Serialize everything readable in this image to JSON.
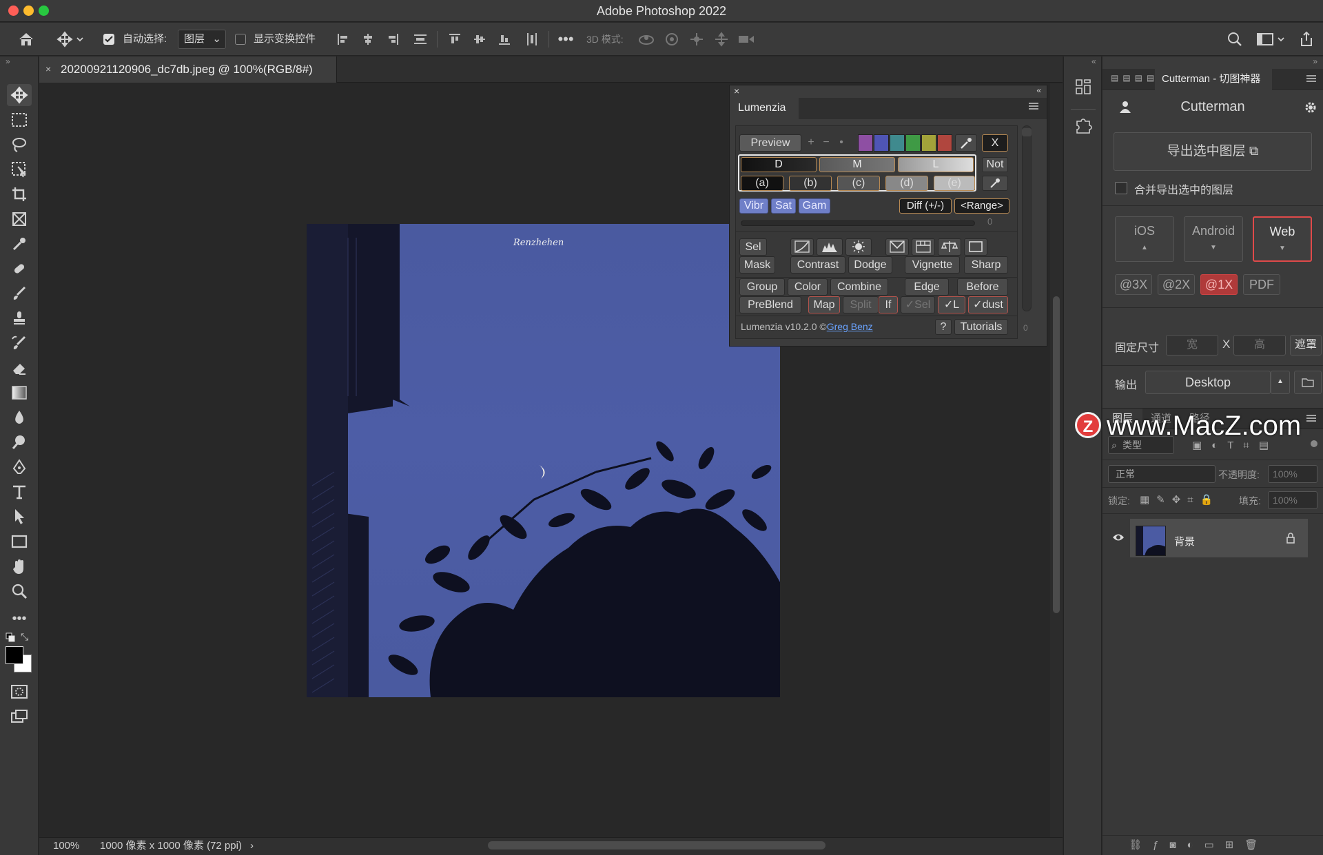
{
  "window": {
    "title": "Adobe Photoshop 2022"
  },
  "options_bar": {
    "auto_select_label": "自动选择:",
    "auto_select_value": "图层",
    "show_transform_label": "显示变换控件",
    "mode_3d_label": "3D 模式:"
  },
  "document": {
    "tab_title": "20200921120906_dc7db.jpeg @ 100%(RGB/8#)",
    "signature": "Renzhehen"
  },
  "status": {
    "zoom": "100%",
    "info": "1000 像素 x 1000 像素 (72 ppi)"
  },
  "lumenzia": {
    "title": "Lumenzia",
    "preview": "Preview",
    "plus": "+",
    "minus": "−",
    "dot": "•",
    "x": "X",
    "dml": [
      "D",
      "M",
      "L"
    ],
    "not": "Not",
    "letters": [
      "(a)",
      "(b)",
      "(c)",
      "(d)",
      "(e)"
    ],
    "vibr": "Vibr",
    "sat": "Sat",
    "gam": "Gam",
    "diff": "Diff (+/-)",
    "range": "<Range>",
    "slider_value": "0",
    "sel": "Sel",
    "mask": "Mask",
    "contrast": "Contrast",
    "dodge": "Dodge",
    "vignette": "Vignette",
    "sharp": "Sharp",
    "group": "Group",
    "color": "Color",
    "combine": "Combine",
    "edge": "Edge",
    "before": "Before",
    "preblend": "PreBlend",
    "map": "Map",
    "split": "Split",
    "if": "If",
    "check_sel": "✓Sel",
    "check_l": "✓L",
    "check_dust": "✓dust",
    "version": "Lumenzia v10.2.0 ©",
    "author": "Greg Benz",
    "help": "?",
    "tutorials": "Tutorials",
    "side_value": "0",
    "swatch_colors": [
      "#8e4fa3",
      "#4f55b5",
      "#3f8a8e",
      "#3f9a45",
      "#a3a33a",
      "#b0463e"
    ]
  },
  "cutterman": {
    "tab_title": "Cutterman - 切图神器",
    "header": "Cutterman",
    "export_button": "导出选中图层",
    "merge_label": "合并导出选中的图层",
    "platforms": [
      "iOS",
      "Android",
      "Web"
    ],
    "scales": [
      "@3X",
      "@2X",
      "@1X",
      "PDF"
    ],
    "fixed_size_label": "固定尺寸",
    "width_placeholder": "宽",
    "x_label": "X",
    "height_placeholder": "高",
    "mask_button": "遮罩",
    "output_label": "输出",
    "output_value": "Desktop"
  },
  "layers_panel": {
    "tabs": [
      "图层",
      "通道",
      "路径"
    ],
    "filter_label": "类型",
    "blend_mode": "正常",
    "opacity_label": "不透明度:",
    "opacity_value": "100%",
    "lock_label": "锁定:",
    "fill_label": "填充:",
    "fill_value": "100%",
    "layer_name": "背景"
  },
  "watermark": {
    "text": "www.MacZ.com",
    "logo_letter": "Z"
  },
  "colors": {
    "accent_red": "#e04a4a",
    "lumenzia_blue": "#6f7fc8",
    "sky": "#4b5ba3",
    "link": "#6aa3ff"
  }
}
